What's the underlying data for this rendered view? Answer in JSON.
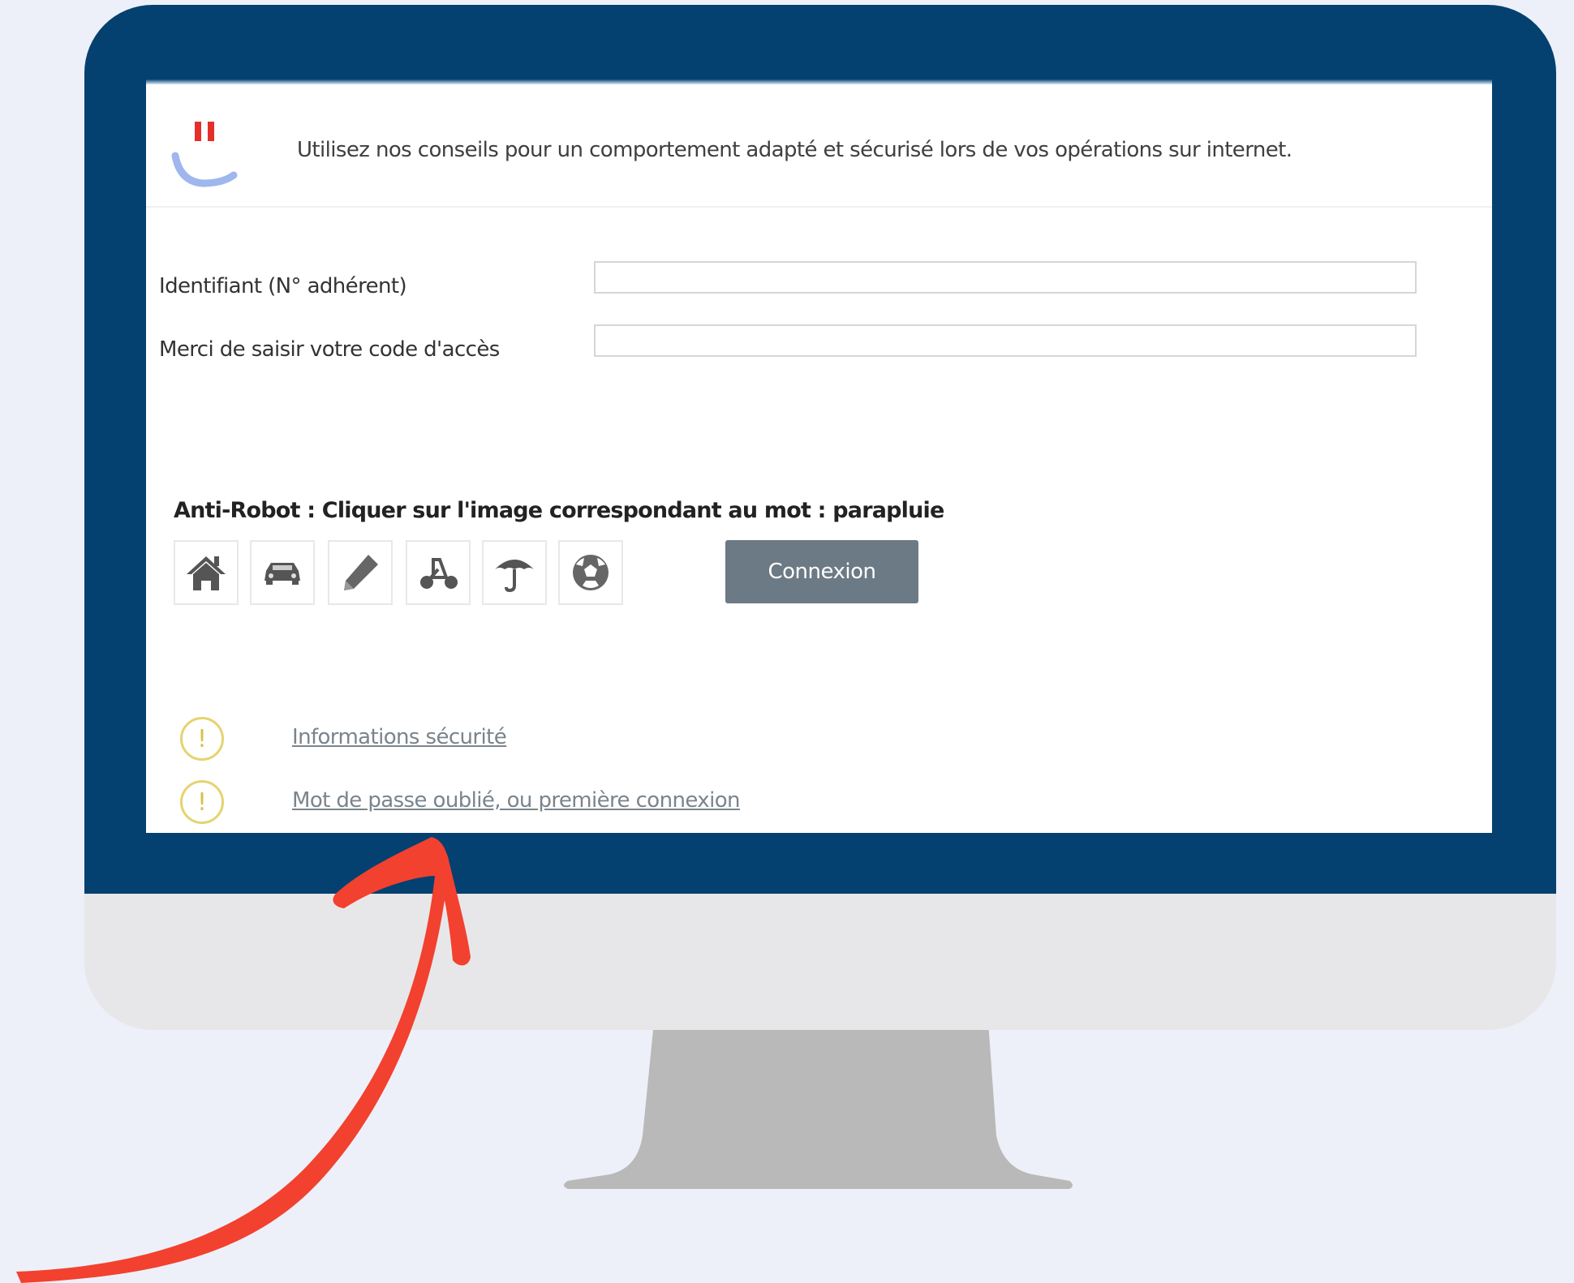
{
  "notice": {
    "text": "Utilisez nos conseils pour un comportement adapté et sécurisé lors de vos opérations sur internet.",
    "logo_icon": "smiley-logo-icon"
  },
  "login_form": {
    "identifier_label": "Identifiant (N° adhérent)",
    "identifier_value": "",
    "access_code_label": "Merci de saisir votre code d'accès",
    "access_code_value": ""
  },
  "anti_robot": {
    "label": "Anti-Robot : Cliquer sur l'image correspondant au mot : parapluie",
    "options": [
      {
        "icon": "house-icon"
      },
      {
        "icon": "car-icon"
      },
      {
        "icon": "pencil-icon"
      },
      {
        "icon": "scooter-icon"
      },
      {
        "icon": "umbrella-icon"
      },
      {
        "icon": "soccer-ball-icon"
      }
    ]
  },
  "connexion_button": {
    "label": "Connexion"
  },
  "links": [
    {
      "label": "Informations sécurité",
      "icon": "warning-icon"
    },
    {
      "label": "Mot de passe oublié, ou première connexion",
      "icon": "warning-icon"
    }
  ],
  "colors": {
    "background": "#edf0f9",
    "monitor_frame": "#044170",
    "monitor_chin": "#e7e7e9",
    "stand": "#b9b9b9",
    "connexion_button": "#6c7a85",
    "warning": "#e6d36f",
    "arrow": "#f2412f"
  }
}
